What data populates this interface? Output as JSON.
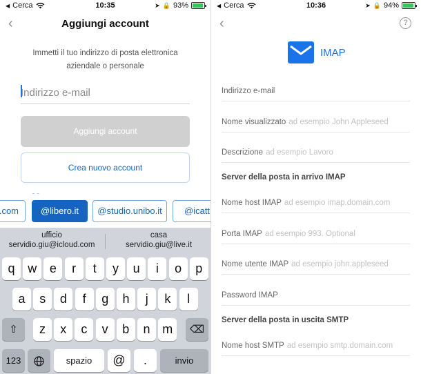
{
  "left": {
    "status": {
      "carrier": "Cerca",
      "time": "10:35",
      "battery": "93%",
      "battery_level": 0.93
    },
    "nav": {
      "title": "Aggiungi account"
    },
    "intro_text": "Immetti il tuo indirizzo di posta elettronica aziendale o personale",
    "email_placeholder": "Indirizzo e-mail",
    "add_account_label": "Aggiungi account",
    "create_account_label": "Crea nuovo account",
    "domain_chips": [
      ".com",
      "@libero.it",
      "@studio.unibo.it",
      "@icatt."
    ],
    "keyboard": {
      "suggestions": [
        {
          "label": "ufficio",
          "value": "servidio.giu@icloud.com"
        },
        {
          "label": "casa",
          "value": "servidio.giu@live.it"
        }
      ],
      "row1": [
        "q",
        "w",
        "e",
        "r",
        "t",
        "y",
        "u",
        "i",
        "o",
        "p"
      ],
      "row2": [
        "a",
        "s",
        "d",
        "f",
        "g",
        "h",
        "j",
        "k",
        "l"
      ],
      "row3": [
        "z",
        "x",
        "c",
        "v",
        "b",
        "n",
        "m"
      ],
      "shift": "⇧",
      "delete": "⌫",
      "numbers": "123",
      "globe": "🌐",
      "space": "spazio",
      "at": "@",
      "dot": ".",
      "return": "invio"
    }
  },
  "right": {
    "status": {
      "carrier": "Cerca",
      "time": "10:36",
      "battery": "94%",
      "battery_level": 0.94
    },
    "help": "?",
    "header_title": "IMAP",
    "fields": [
      {
        "label": "Indirizzo e-mail",
        "placeholder": ""
      },
      {
        "label": "Nome visualizzato",
        "placeholder": "ad esempio John Appleseed"
      },
      {
        "label": "Descrizione",
        "placeholder": "ad esempio Lavoro"
      }
    ],
    "incoming_section": "Server della posta in arrivo IMAP",
    "incoming_fields": [
      {
        "label": "Nome host IMAP",
        "placeholder": "ad esempio imap.domain.com"
      },
      {
        "label": "Porta IMAP",
        "placeholder": "ad esempio 993. Optional"
      },
      {
        "label": "Nome utente IMAP",
        "placeholder": "ad esempio john.appleseed"
      },
      {
        "label": "Password IMAP",
        "placeholder": ""
      }
    ],
    "outgoing_section": "Server della posta in uscita SMTP",
    "outgoing_fields": [
      {
        "label": "Nome host SMTP",
        "placeholder": "ad esempio smtp.domain.com"
      }
    ]
  },
  "colors": {
    "accent": "#1565c0",
    "keyboard_bg": "#d1d4da",
    "button_disabled": "#d0d0d0",
    "battery": "#34c759"
  }
}
